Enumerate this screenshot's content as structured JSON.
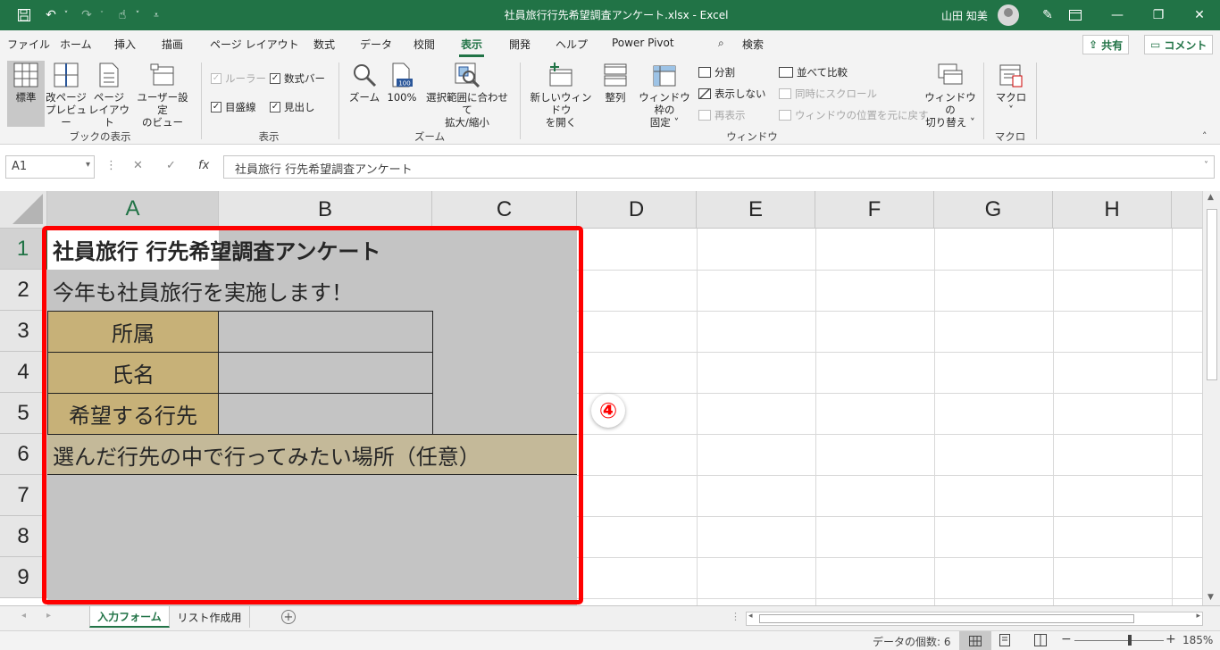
{
  "titlebar": {
    "title": "社員旅行行先希望調査アンケート.xlsx  -  Excel",
    "user": "山田 知美",
    "minimize": "—",
    "restore": "❐",
    "close": "✕"
  },
  "menu_tabs": [
    "ファイル",
    "ホーム",
    "挿入",
    "描画",
    "ページ レイアウト",
    "数式",
    "データ",
    "校閲",
    "表示",
    "開発",
    "ヘルプ",
    "Power Pivot"
  ],
  "active_tab": "表示",
  "search_label": "検索",
  "share_label": "共有",
  "comment_label": "コメント",
  "ribbon": {
    "views": {
      "normal": "標準",
      "page_break": "改ページ\nプレビュー",
      "page_layout": "ページ\nレイアウト",
      "custom_views": "ユーザー設定\nのビュー",
      "group": "ブックの表示"
    },
    "show": {
      "ruler": "ルーラー",
      "formula_bar": "数式バー",
      "gridlines": "目盛線",
      "headings": "見出し",
      "group": "表示"
    },
    "zoom": {
      "zoom": "ズーム",
      "zoom100": "100%",
      "zoom_selection": "選択範囲に合わせて\n拡大/縮小",
      "group": "ズーム",
      "icon_text": "100"
    },
    "window": {
      "new_window": "新しいウィンドウ\nを開く",
      "arrange": "整列",
      "freeze": "ウィンドウ枠の\n固定 ˅",
      "split": "分割",
      "hide": "表示しない",
      "unhide": "再表示",
      "side_by_side": "並べて比較",
      "sync_scroll": "同時にスクロール",
      "reset_position": "ウィンドウの位置を元に戻す",
      "switch_windows": "ウィンドウの\n切り替え ˅",
      "group": "ウィンドウ"
    },
    "macro": {
      "macros": "マクロ\n˅",
      "group": "マクロ"
    }
  },
  "formula_bar": {
    "name_box": "A1",
    "formula": "社員旅行 行先希望調査アンケート",
    "cancel": "✕",
    "enter": "✓",
    "fx": "fx"
  },
  "columns": [
    "A",
    "B",
    "C",
    "D",
    "E",
    "F",
    "G",
    "H"
  ],
  "rows": [
    "1",
    "2",
    "3",
    "4",
    "5",
    "6",
    "7",
    "8",
    "9"
  ],
  "cells": {
    "a1": "社員旅行 行先希望調査アンケート",
    "a2": "今年も社員旅行を実施します！",
    "a3": "所属",
    "a4": "氏名",
    "a5": "希望する行先",
    "a6": "選んだ行先の中で行ってみたい場所（任意）"
  },
  "annotation_number": "④",
  "sheet_tabs": [
    "入力フォーム",
    "リスト作成用"
  ],
  "active_sheet": "入力フォーム",
  "statusbar": {
    "count": "データの個数: 6",
    "zoom": "185%"
  },
  "colors": {
    "excel_green": "#217346",
    "label_fill": "#c7b178",
    "row6_fill": "#c4b999",
    "form_gray": "#c4c4c4",
    "annotation_red": "#ff0000"
  }
}
